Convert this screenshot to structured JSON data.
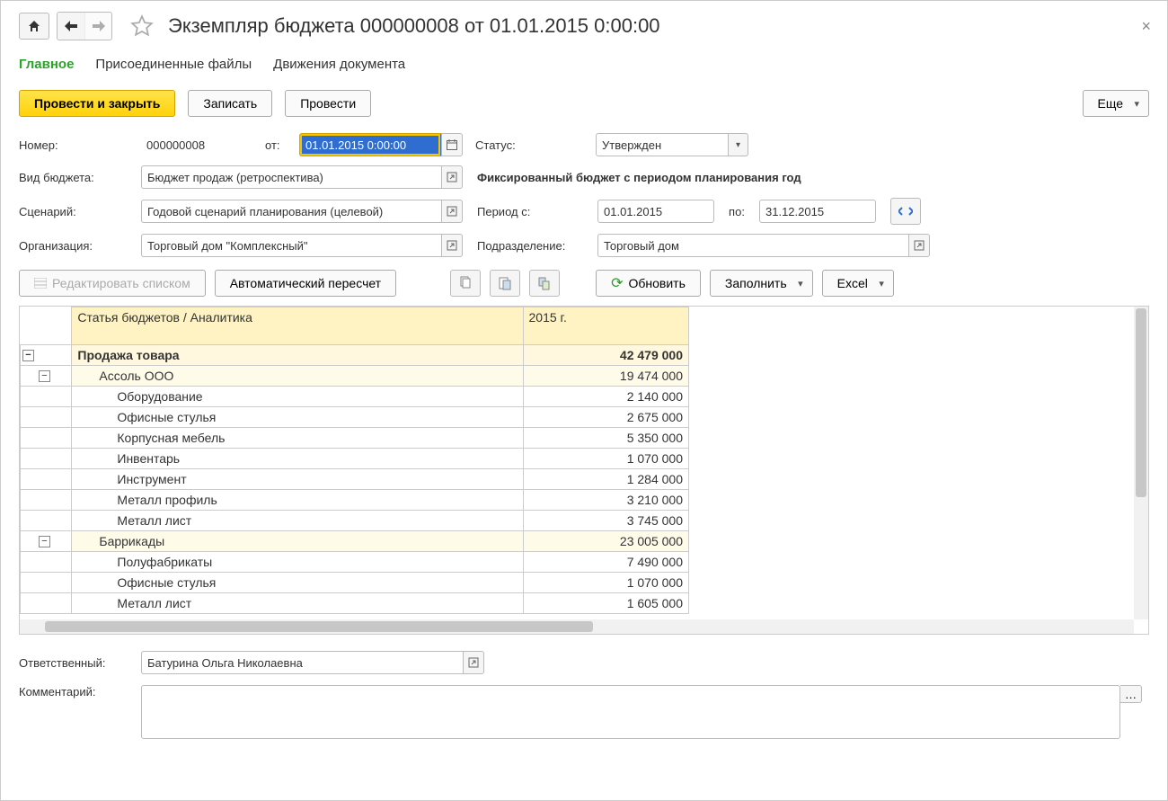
{
  "header": {
    "title": "Экземпляр бюджета 000000008 от 01.01.2015 0:00:00"
  },
  "tabs": {
    "main": "Главное",
    "attached": "Присоединенные файлы",
    "movements": "Движения документа"
  },
  "commands": {
    "post_close": "Провести и закрыть",
    "save": "Записать",
    "post": "Провести",
    "more": "Еще"
  },
  "form": {
    "number_label": "Номер:",
    "number": "000000008",
    "from_label": "от:",
    "date": "01.01.2015  0:00:00",
    "status_label": "Статус:",
    "status": "Утвержден",
    "budget_type_label": "Вид бюджета:",
    "budget_type": "Бюджет продаж (ретроспектива)",
    "fixed_hint": "Фиксированный бюджет с периодом планирования год",
    "scenario_label": "Сценарий:",
    "scenario": "Годовой сценарий планирования (целевой)",
    "period_from_label": "Период с:",
    "period_from": "01.01.2015",
    "period_to_label": "по:",
    "period_to": "31.12.2015",
    "org_label": "Организация:",
    "org": "Торговый дом \"Комплексный\"",
    "unit_label": "Подразделение:",
    "unit": "Торговый дом"
  },
  "grid_toolbar": {
    "edit_list": "Редактировать списком",
    "auto_recalc": "Автоматический пересчет",
    "refresh": "Обновить",
    "fill": "Заполнить",
    "excel": "Excel"
  },
  "grid": {
    "col1": "Статья бюджетов / Аналитика",
    "col2": "2015 г.",
    "rows": [
      {
        "level": 0,
        "label": "Продажа товара",
        "value": "42 479 000",
        "group": true
      },
      {
        "level": 1,
        "label": "Ассоль ООО",
        "value": "19 474 000",
        "subgroup": true
      },
      {
        "level": 2,
        "label": "Оборудование",
        "value": "2 140 000"
      },
      {
        "level": 2,
        "label": "Офисные стулья",
        "value": "2 675 000"
      },
      {
        "level": 2,
        "label": "Корпусная мебель",
        "value": "5 350 000"
      },
      {
        "level": 2,
        "label": "Инвентарь",
        "value": "1 070 000"
      },
      {
        "level": 2,
        "label": "Инструмент",
        "value": "1 284 000"
      },
      {
        "level": 2,
        "label": "Металл профиль",
        "value": "3 210 000"
      },
      {
        "level": 2,
        "label": "Металл лист",
        "value": "3 745 000"
      },
      {
        "level": 1,
        "label": "Баррикады",
        "value": "23 005 000",
        "subgroup": true
      },
      {
        "level": 2,
        "label": "Полуфабрикаты",
        "value": "7 490 000"
      },
      {
        "level": 2,
        "label": "Офисные стулья",
        "value": "1 070 000"
      },
      {
        "level": 2,
        "label": "Металл лист",
        "value": "1 605 000"
      }
    ]
  },
  "bottom": {
    "responsible_label": "Ответственный:",
    "responsible": "Батурина Ольга Николаевна",
    "comment_label": "Комментарий:",
    "comment": ""
  }
}
